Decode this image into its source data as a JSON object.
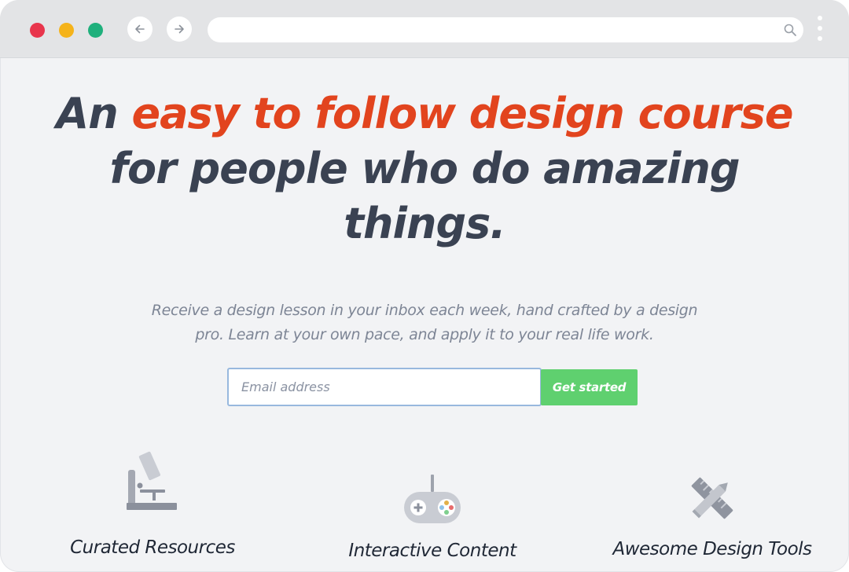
{
  "colors": {
    "accent": "#e2441e",
    "heading": "#3a4252",
    "muted": "#7d8595",
    "cta": "#5fd06f",
    "traffic_red": "#e8354c",
    "traffic_yellow": "#f5b31a",
    "traffic_green": "#1fb07c"
  },
  "browser": {
    "url": "",
    "icons": [
      "back-arrow-icon",
      "forward-arrow-icon",
      "search-icon",
      "kebab-menu-icon"
    ]
  },
  "hero": {
    "headline_lead": "An ",
    "headline_highlight": "easy to follow design course",
    "headline_rest": " for people who do amazing things.",
    "lead": "Receive a design lesson in your inbox each week, hand crafted by a design pro. Learn at your own pace, and apply it to your real life work."
  },
  "signup": {
    "email_value": "",
    "email_placeholder": "Email address",
    "button_label": "Get started"
  },
  "features": [
    {
      "icon": "microscope-icon",
      "label": "Curated Resources"
    },
    {
      "icon": "gamepad-icon",
      "label": "Interactive Content"
    },
    {
      "icon": "ruler-pencil-icon",
      "label": "Awesome Design Tools"
    }
  ]
}
